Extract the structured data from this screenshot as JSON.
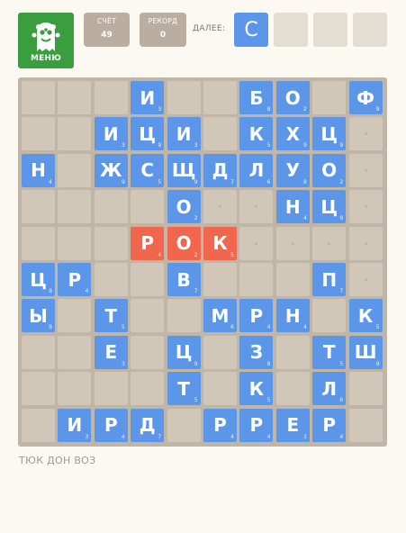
{
  "menu": {
    "label": "МЕНЮ"
  },
  "score": {
    "title": "СЧЁТ",
    "value": "49"
  },
  "record": {
    "title": "РЕКОРД",
    "value": "0"
  },
  "next": {
    "label": "ДАЛЕЕ:",
    "tiles": [
      "С",
      "",
      "",
      ""
    ]
  },
  "colors": {
    "tile": "#5b96e8",
    "word": "#f1664d",
    "menu": "#3a9e3f",
    "board": "#c1b6a6"
  },
  "found_words": "ТЮК ДОН ВОЗ",
  "board": [
    [
      null,
      null,
      null,
      {
        "l": "И",
        "p": "3"
      },
      null,
      null,
      {
        "l": "Б",
        "p": "8"
      },
      {
        "l": "О",
        "p": "2"
      },
      null,
      {
        "l": "Ф",
        "p": "9"
      }
    ],
    [
      null,
      null,
      {
        "l": "И",
        "p": "3"
      },
      {
        "l": "Ц",
        "p": "9"
      },
      {
        "l": "И",
        "p": "3"
      },
      null,
      {
        "l": "К",
        "p": "5"
      },
      {
        "l": "Х",
        "p": "9"
      },
      {
        "l": "Ц",
        "p": "9"
      },
      "."
    ],
    [
      {
        "l": "Н",
        "p": "4"
      },
      null,
      {
        "l": "Ж",
        "p": "9"
      },
      {
        "l": "С",
        "p": "5"
      },
      {
        "l": "Щ",
        "p": "9"
      },
      {
        "l": "Д",
        "p": "7"
      },
      {
        "l": "Л",
        "p": "6"
      },
      {
        "l": "У",
        "p": "8"
      },
      {
        "l": "О",
        "p": "2"
      },
      "."
    ],
    [
      null,
      null,
      null,
      null,
      {
        "l": "О",
        "p": "2"
      },
      ".",
      ".",
      {
        "l": "Н",
        "p": "4"
      },
      {
        "l": "Ц",
        "p": "9"
      },
      "."
    ],
    [
      null,
      null,
      null,
      {
        "l": "Р",
        "p": "4",
        "w": true
      },
      {
        "l": "О",
        "p": "2",
        "w": true
      },
      {
        "l": "К",
        "p": "5",
        "w": true
      },
      ".",
      ".",
      ".",
      "."
    ],
    [
      {
        "l": "Ц",
        "p": "9"
      },
      {
        "l": "Р",
        "p": "4"
      },
      null,
      null,
      {
        "l": "В",
        "p": "7"
      },
      null,
      null,
      null,
      {
        "l": "П",
        "p": "7"
      },
      "."
    ],
    [
      {
        "l": "Ы",
        "p": "9"
      },
      null,
      {
        "l": "Т",
        "p": "5"
      },
      null,
      null,
      {
        "l": "М",
        "p": "6"
      },
      {
        "l": "Р",
        "p": "4"
      },
      {
        "l": "Н",
        "p": "4"
      },
      null,
      {
        "l": "К",
        "p": "5"
      }
    ],
    [
      null,
      null,
      {
        "l": "Е",
        "p": "3"
      },
      null,
      {
        "l": "Ц",
        "p": "9"
      },
      null,
      {
        "l": "З",
        "p": "8"
      },
      null,
      {
        "l": "Т",
        "p": "5"
      },
      {
        "l": "Ш",
        "p": "9"
      }
    ],
    [
      null,
      null,
      null,
      null,
      {
        "l": "Т",
        "p": "5"
      },
      null,
      {
        "l": "К",
        "p": "5"
      },
      null,
      {
        "l": "Л",
        "p": "6"
      },
      null
    ],
    [
      null,
      {
        "l": "И",
        "p": "3"
      },
      {
        "l": "Р",
        "p": "4"
      },
      {
        "l": "Д",
        "p": "7"
      },
      null,
      {
        "l": "Р",
        "p": "4"
      },
      {
        "l": "Р",
        "p": "4"
      },
      {
        "l": "Е",
        "p": "3"
      },
      {
        "l": "Р",
        "p": "4"
      },
      null
    ]
  ]
}
